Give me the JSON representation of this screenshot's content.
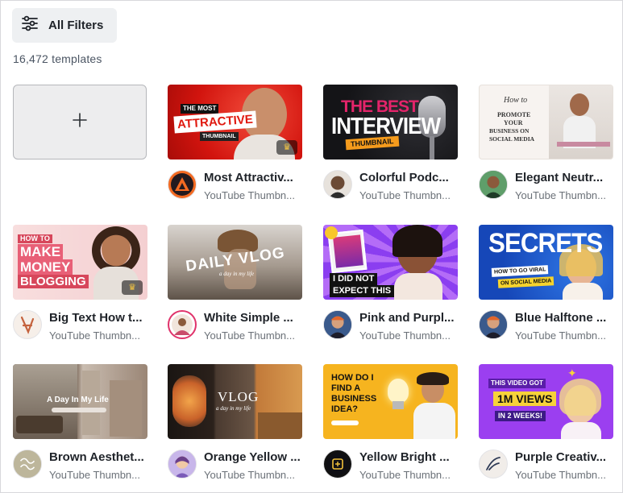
{
  "toolbar": {
    "filters_label": "All Filters",
    "filters_icon": "sliders-icon"
  },
  "results": {
    "count_text": "16,472 templates"
  },
  "create_blank": {
    "icon": "plus-icon"
  },
  "templates": [
    {
      "title": "Most Attractiv...",
      "subtitle": "YouTube Thumbn...",
      "thumb_lines": [
        "THE MOST",
        "ATTRACTIVE",
        "THUMBNAIL"
      ],
      "premium": true
    },
    {
      "title": "Colorful Podc...",
      "subtitle": "YouTube Thumbn...",
      "thumb_lines": [
        "THE BEST",
        "INTERVIEW",
        "THUMBNAIL"
      ],
      "premium": false
    },
    {
      "title": "Elegant Neutr...",
      "subtitle": "YouTube Thumbn...",
      "thumb_lines": [
        "How to",
        "PROMOTE",
        "YOUR",
        "BUSINESS ON",
        "SOCIAL MEDIA"
      ],
      "premium": false
    },
    {
      "title": "Big Text How t...",
      "subtitle": "YouTube Thumbn...",
      "thumb_lines": [
        "HOW TO",
        "MAKE",
        "MONEY",
        "BLOGGING"
      ],
      "premium": true
    },
    {
      "title": "White Simple ...",
      "subtitle": "YouTube Thumbn...",
      "thumb_lines": [
        "DAILY VLOG",
        "a day in my life"
      ],
      "premium": false
    },
    {
      "title": "Pink and Purpl...",
      "subtitle": "YouTube Thumbn...",
      "thumb_lines": [
        "I DID NOT",
        "EXPECT THIS"
      ],
      "premium": false
    },
    {
      "title": "Blue Halftone ...",
      "subtitle": "YouTube Thumbn...",
      "thumb_lines": [
        "SECRETS",
        "HOW TO GO VIRAL",
        "ON SOCIAL MEDIA"
      ],
      "premium": false
    },
    {
      "title": "Brown Aesthet...",
      "subtitle": "YouTube Thumbn...",
      "thumb_lines": [
        "A Day In My Life"
      ],
      "premium": false
    },
    {
      "title": "Orange Yellow ...",
      "subtitle": "YouTube Thumbn...",
      "thumb_lines": [
        "VLOG",
        "a day in my life"
      ],
      "premium": false
    },
    {
      "title": "Yellow Bright ...",
      "subtitle": "YouTube Thumbn...",
      "thumb_lines": [
        "HOW DO I",
        "FIND A",
        "BUSINESS",
        "IDEA?"
      ],
      "premium": false
    },
    {
      "title": "Purple Creativ...",
      "subtitle": "YouTube Thumbn...",
      "thumb_lines": [
        "THIS VIDEO GOT",
        "1M VIEWS",
        "IN 2 WEEKS!"
      ],
      "premium": false
    }
  ]
}
